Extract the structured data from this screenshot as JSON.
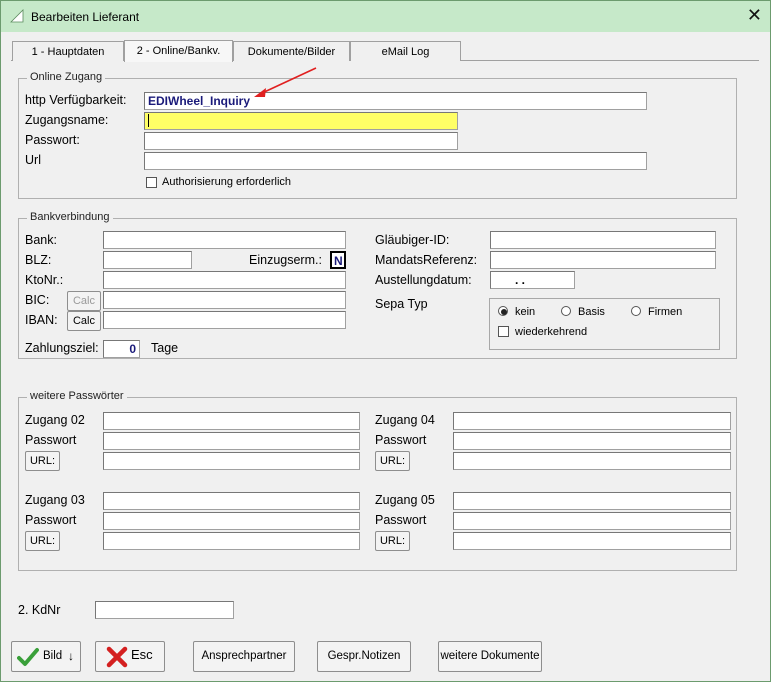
{
  "window": {
    "title": "Bearbeiten Lieferant",
    "close_glyph": "✕"
  },
  "tabs": [
    {
      "label": "1 - Hauptdaten"
    },
    {
      "label": "2 - Online/Bankv."
    },
    {
      "label": "Dokumente/Bilder"
    },
    {
      "label": "eMail Log"
    }
  ],
  "online": {
    "title": "Online Zugang",
    "http_label": "http Verfügbarkeit:",
    "http_value": "EDIWheel_Inquiry",
    "user_label": "Zugangsname:",
    "user_value": "",
    "pass_label": "Passwort:",
    "pass_value": "",
    "url_label": "Url",
    "url_value": "",
    "auth_label": "Authorisierung erforderlich",
    "auth_checked": false
  },
  "bank": {
    "title": "Bankverbindung",
    "bank_label": "Bank:",
    "blz_label": "BLZ:",
    "einzug_label": "Einzugserm.:",
    "einzug_value": "N",
    "kto_label": "KtoNr.:",
    "bic_label": "BIC:",
    "iban_label": "IBAN:",
    "calc_label": "Calc",
    "ziel_label": "Zahlungsziel:",
    "ziel_value": "0",
    "tage_label": "Tage",
    "glaeubiger_label": "Gläubiger-ID:",
    "mandat_label": "MandatsReferenz:",
    "ausstellung_label": "Austellungdatum:",
    "ausstellung_value": ".   .",
    "sepa_label": "Sepa Typ",
    "sepa_options": [
      "kein",
      "Basis",
      "Firmen"
    ],
    "sepa_selected": "kein",
    "wiederkehrend_label": "wiederkehrend"
  },
  "passwords": {
    "title": "weitere Passwörter",
    "zugang02": "Zugang 02",
    "zugang03": "Zugang 03",
    "zugang04": "Zugang 04",
    "zugang05": "Zugang 05",
    "passwort_label": "Passwort",
    "url_button": "URL:"
  },
  "kdnr": {
    "label": "2. KdNr",
    "value": ""
  },
  "buttons": {
    "bild": "Bild",
    "esc": "Esc",
    "ansprech": "Ansprechpartner",
    "notizen": "Gespr.Notizen",
    "dokumente": "weitere Dokumente"
  },
  "colors": {
    "titlebar": "#c6e9c9",
    "highlight_field": "#ffff66",
    "arrow": "#e02020"
  }
}
